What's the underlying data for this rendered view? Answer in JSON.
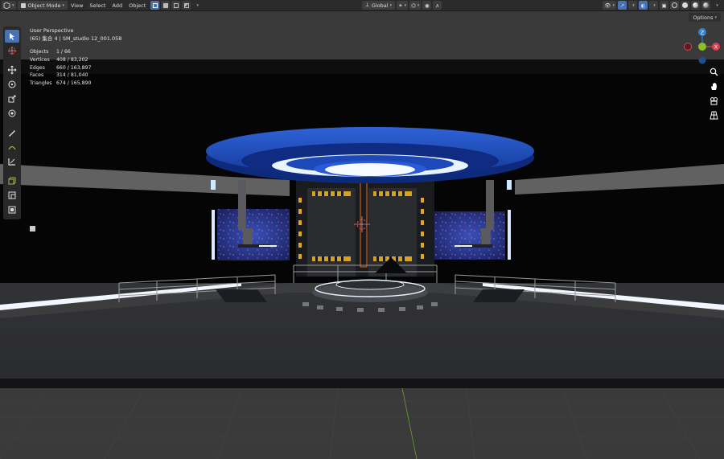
{
  "header": {
    "mode_label": "Object Mode",
    "menus": [
      "View",
      "Select",
      "Add",
      "Object"
    ],
    "transform_orientation": "Global",
    "options_label": "Options"
  },
  "overlay": {
    "view_name": "User Perspective",
    "collection_info": "(65) 集合 4 | SM_studio 12_001.058",
    "stats": [
      {
        "label": "Objects",
        "value": "1 / 66"
      },
      {
        "label": "Vertices",
        "value": "408 / 83,202"
      },
      {
        "label": "Edges",
        "value": "660 / 163,897"
      },
      {
        "label": "Faces",
        "value": "314 / 81,040"
      },
      {
        "label": "Triangles",
        "value": "674 / 165,890"
      }
    ]
  },
  "gizmo": {
    "z_label": "Z",
    "x_label": "X",
    "colors": {
      "x": "#d9404f",
      "y": "#8cbf26",
      "z": "#2e84d9"
    }
  },
  "icons": {
    "toolbar": [
      "select-box-icon",
      "cursor-icon",
      "move-icon",
      "rotate-icon",
      "scale-icon",
      "transform-icon",
      "annotate-icon",
      "measure-icon",
      "add-cube-icon",
      "extrude-icon",
      "inset-icon"
    ],
    "nav": [
      "zoom-icon",
      "hand-pan-icon",
      "camera-icon",
      "grid-view-icon"
    ]
  },
  "colors": {
    "accent": "#4772b3",
    "stage_blue": "#1f4fc4",
    "light_strip": "#e8f4ff"
  }
}
